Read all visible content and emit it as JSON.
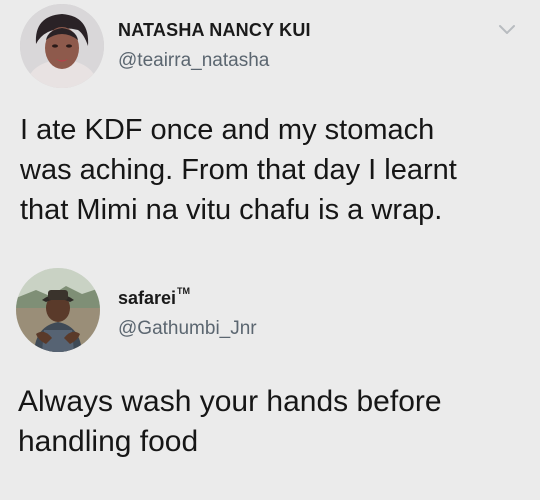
{
  "tweets": [
    {
      "display_name": "NATASHA NANCY KUI",
      "handle": "@teairra_natasha",
      "text": "I ate KDF once and my stomach\nwas aching. From that day I learnt\nthat Mimi na vitu chafu is a wrap.",
      "menu_icon": "chevron-down-icon"
    },
    {
      "display_name": "safarei",
      "name_badge": "TM",
      "handle": "@Gathumbi_Jnr",
      "text": "Always wash your hands before\nhandling food"
    }
  ]
}
